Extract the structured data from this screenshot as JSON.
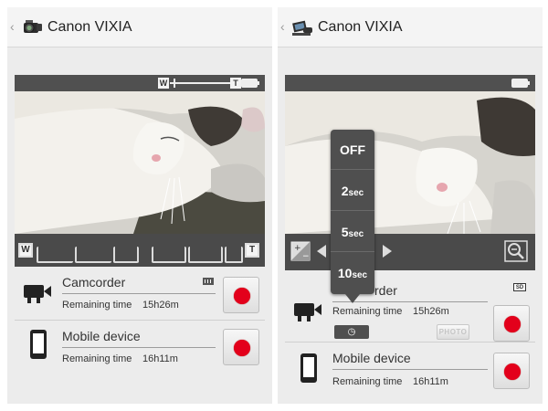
{
  "app": {
    "title": "Canon VIXIA"
  },
  "left": {
    "zoom_wide": "W",
    "zoom_tele": "T",
    "camcorder": {
      "title": "Camcorder",
      "remaining_label": "Remaining time",
      "remaining_value": "15h26m"
    },
    "mobile": {
      "title": "Mobile device",
      "remaining_label": "Remaining time",
      "remaining_value": "16h11m"
    }
  },
  "right": {
    "timer_menu": {
      "options": [
        {
          "value": "OFF",
          "unit": ""
        },
        {
          "value": "2",
          "unit": "sec"
        },
        {
          "value": "5",
          "unit": "sec"
        },
        {
          "value": "10",
          "unit": "sec"
        }
      ]
    },
    "camcorder": {
      "title_visible": "rder",
      "remaining_label": "Remaining time",
      "remaining_value": "15h26m",
      "storage_badge": "SD",
      "photo_label": "PHOTO"
    },
    "mobile": {
      "title": "Mobile device",
      "remaining_label": "Remaining time",
      "remaining_value": "16h11m"
    }
  },
  "colors": {
    "record": "#e3001b",
    "toolbar": "#4b4b4b",
    "background": "#ececec"
  },
  "icons": [
    "back-chevron-icon",
    "camcorder-logo-icon",
    "battery-icon",
    "camcorder-icon",
    "mobile-device-icon",
    "record-icon",
    "exposure-icon",
    "left-arrow-icon",
    "right-arrow-icon",
    "zoom-out-icon",
    "self-timer-icon"
  ]
}
